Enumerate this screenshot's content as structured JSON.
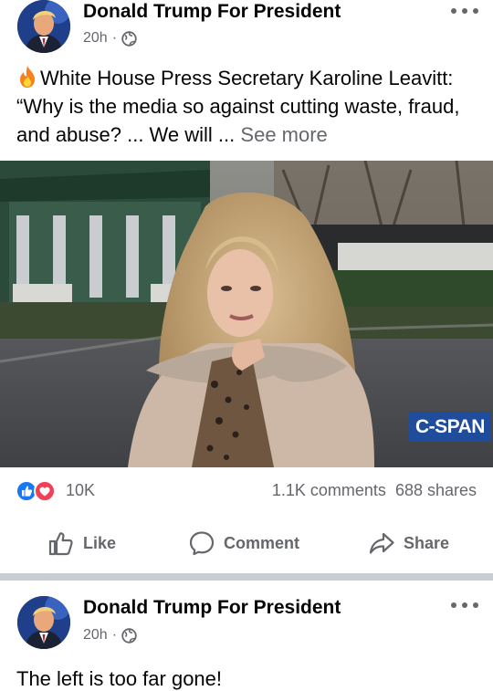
{
  "post1": {
    "page_name": "Donald Trump For President",
    "time": "20h",
    "separator": "·",
    "text": "White House Press Secretary Karoline Leavitt: “Why is the media so against cutting waste, fraud, and abuse? ... We will ...",
    "see_more": "See more",
    "video": {
      "watermark": "C-SPAN"
    },
    "reactions": {
      "count": "10K",
      "icons": [
        "like",
        "love"
      ]
    },
    "comments": "1.1K comments",
    "shares": "688 shares",
    "actions": {
      "like": "Like",
      "comment": "Comment",
      "share": "Share"
    }
  },
  "post2": {
    "page_name": "Donald Trump For President",
    "time": "20h",
    "separator": "·",
    "text": "The left is too far gone!"
  },
  "colors": {
    "primary_text": "#050505",
    "secondary_text": "#65676b",
    "like_blue": "#1877f2",
    "love_red": "#f33e58",
    "cspan_blue": "#1f4d9b",
    "divider": "#c9ccd1"
  }
}
